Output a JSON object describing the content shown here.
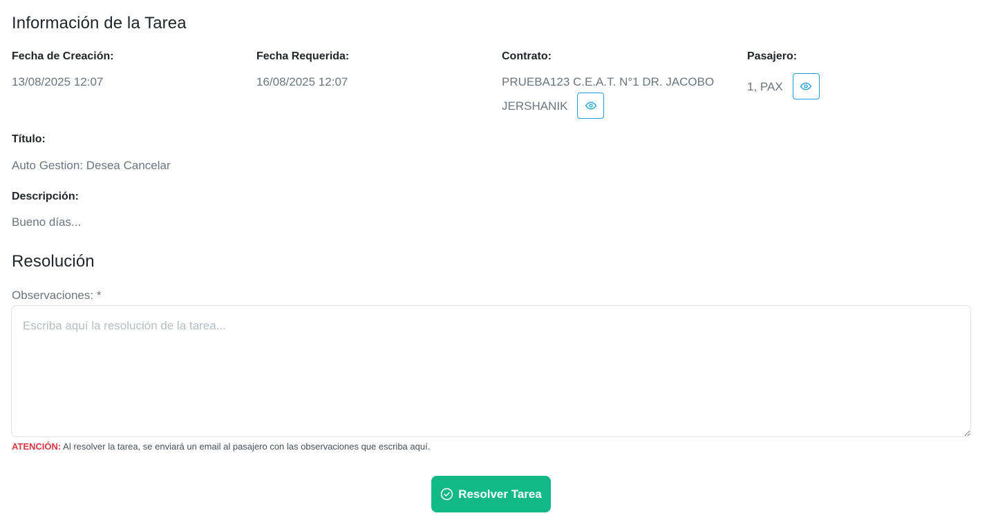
{
  "info": {
    "title": "Información de la Tarea",
    "fecha_creacion": {
      "label": "Fecha de Creación:",
      "value": "13/08/2025 12:07"
    },
    "fecha_requerida": {
      "label": "Fecha Requerida:",
      "value": "16/08/2025 12:07"
    },
    "contrato": {
      "label": "Contrato:",
      "value_line1": "PRUEBA123 C.E.A.T. N°1 DR. JACOBO",
      "value_line2": "JERSHANIK",
      "view_icon": "eye-icon"
    },
    "pasajero": {
      "label": "Pasajero:",
      "value": "1, PAX",
      "view_icon": "eye-icon"
    },
    "titulo": {
      "label": "Título:",
      "value": "Auto Gestion: Desea Cancelar"
    },
    "descripcion": {
      "label": "Descripción:",
      "value": "Bueno días..."
    }
  },
  "resolucion": {
    "title": "Resolución",
    "observaciones_label": "Observaciones: *",
    "observaciones_placeholder": "Escriba aquí la resolución de la tarea...",
    "observaciones_value": "",
    "warning_strong": "ATENCIÓN:",
    "warning_text": "Al resolver la tarea, se enviará un email al pasajero con las observaciones que escriba aquí.",
    "resolve_button_label": "Resolver Tarea",
    "resolve_button_icon": "check-circle-icon"
  },
  "colors": {
    "accent_info": "#1a9fd6",
    "success": "#12b886",
    "danger": "#dc3545",
    "muted": "#6c757d"
  }
}
